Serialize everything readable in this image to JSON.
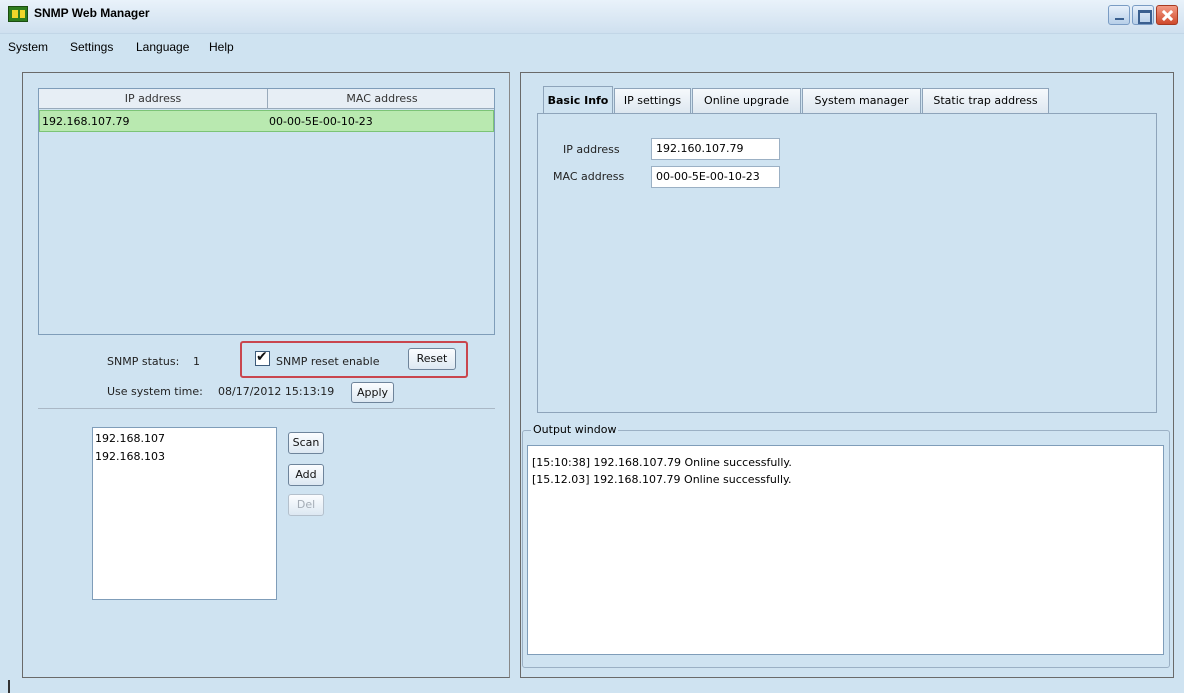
{
  "window": {
    "title": "SNMP Web Manager"
  },
  "menu": [
    "System",
    "Settings",
    "Language",
    "Help"
  ],
  "device_table": {
    "headers": [
      "IP address",
      "MAC address"
    ],
    "rows": [
      {
        "ip": "192.168.107.79",
        "mac": "00-00-5E-00-10-23"
      }
    ]
  },
  "snmp": {
    "status_label": "SNMP status:",
    "status_value": "1",
    "reset_enable_label": "SNMP reset enable",
    "reset_enable_checked": true,
    "reset_button": "Reset",
    "system_time_label": "Use system time:",
    "system_time_value": "08/17/2012 15:13:19",
    "apply_button": "Apply"
  },
  "scan": {
    "items": [
      "192.168.107",
      "192.168.103"
    ],
    "scan_button": "Scan",
    "add_button": "Add",
    "del_button": "Del"
  },
  "tabs": [
    "Basic Info",
    "IP settings",
    "Online upgrade",
    "System manager",
    "Static trap address"
  ],
  "active_tab": "Basic Info",
  "basic_info": {
    "ip_label": "IP address",
    "ip_value": "192.160.107.79",
    "mac_label": "MAC address",
    "mac_value": "00-00-5E-00-10-23"
  },
  "output": {
    "legend": "Output window",
    "lines": [
      "[15:10:38]  192.168.107.79 Online successfully.",
      "[15.12.03]  192.168.107.79 Online successfully."
    ]
  },
  "colors": {
    "highlight_border": "#c9464e",
    "selected_row": "#b9e9b0",
    "background": "#cfe3f1"
  },
  "icons": [
    "app-icon",
    "minimize-icon",
    "maximize-icon",
    "close-icon",
    "checkmark-icon"
  ]
}
